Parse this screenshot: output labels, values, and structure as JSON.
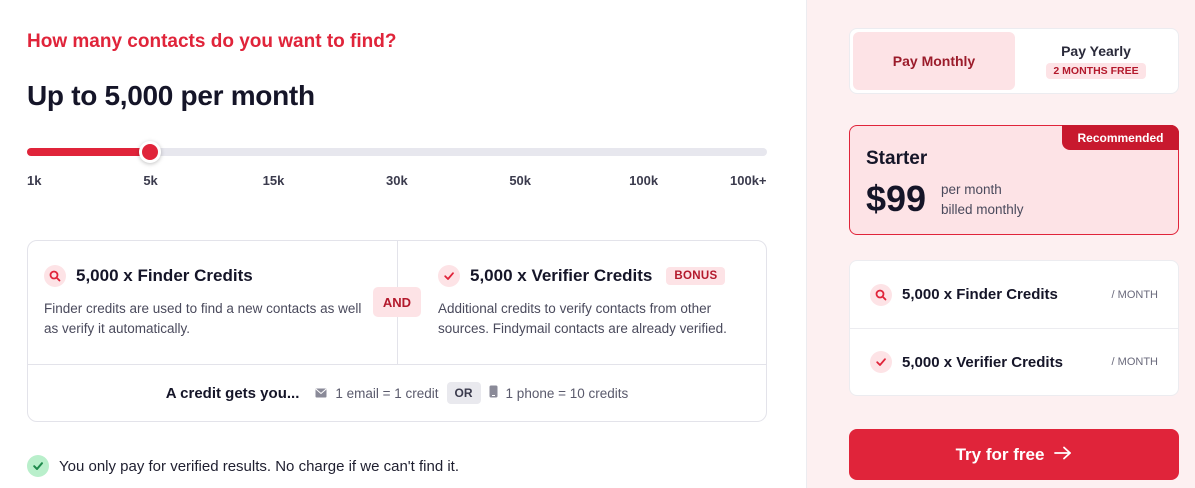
{
  "contacts": {
    "question": "How many contacts do you want to find?",
    "headline": "Up to 5,000 per month",
    "slider": {
      "ticks": [
        "1k",
        "5k",
        "15k",
        "30k",
        "50k",
        "100k",
        "100k+"
      ],
      "selected_index": 1,
      "selected_value": "5k"
    }
  },
  "credits": {
    "finder": {
      "title": "5,000 x Finder Credits",
      "description": "Finder credits are used to find a new contacts as well as verify it automatically.",
      "icon": "search-icon"
    },
    "and_label": "AND",
    "verifier": {
      "title": "5,000 x Verifier Credits",
      "badge": "BONUS",
      "description": "Additional credits to verify contacts from other sources. Findymail contacts are already verified.",
      "icon": "check-icon"
    },
    "credit_gets": {
      "lead": "A credit gets you...",
      "email": "1 email = 1 credit",
      "or_label": "OR",
      "phone": "1 phone = 10 credits"
    }
  },
  "guarantee": {
    "text": "You only pay for verified results. No charge if we can't find it."
  },
  "billing": {
    "monthly_label": "Pay Monthly",
    "yearly_label": "Pay Yearly",
    "yearly_badge": "2 MONTHS FREE",
    "selected": "monthly"
  },
  "plan": {
    "badge": "Recommended",
    "name": "Starter",
    "price": "$99",
    "period": "per month",
    "billing_note": "billed monthly"
  },
  "summary": [
    {
      "title": "5,000 x Finder Credits",
      "period": "/ MONTH",
      "icon": "search-icon"
    },
    {
      "title": "5,000 x Verifier Credits",
      "period": "/ MONTH",
      "icon": "check-icon"
    }
  ],
  "cta": {
    "label": "Try for free",
    "icon": "arrow-right-icon"
  },
  "colors": {
    "accent": "#e0243a",
    "accent_soft": "#fde3e6",
    "panel_bg": "#fdf0f1",
    "success": "#b9efcb"
  }
}
